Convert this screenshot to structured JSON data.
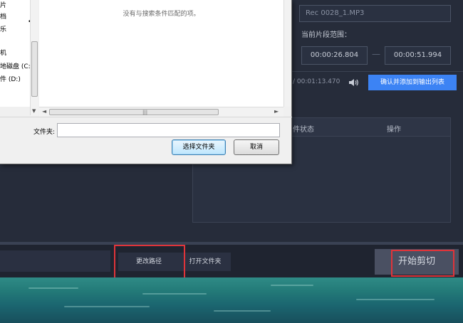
{
  "dialog": {
    "tree_items": [
      "片",
      "档",
      "乐",
      "机",
      "地磁盘 (C:)",
      "件 (D:)"
    ],
    "empty_message": "没有与搜索条件匹配的项。",
    "folder_label": "文件夹:",
    "folder_value": "",
    "select_button": "选择文件夹",
    "cancel_button": "取消"
  },
  "clip": {
    "filename": "Rec 0028_1.MP3",
    "range_label": "当前片段范围：",
    "start_time": "00:00:26.804",
    "end_time": "00:00:51.994",
    "separator": "—",
    "duration": "/ 00:01:13.470",
    "confirm_button": "确认并添加到输出列表"
  },
  "table": {
    "columns": [
      "件状态",
      "操作"
    ]
  },
  "bottom_bar": {
    "change_path_button": "更改路径",
    "open_folder_button": "打开文件夹",
    "start_button": "开始剪切"
  },
  "colors": {
    "accent": "#3c83f4",
    "highlight": "#e0343a",
    "app_bg": "#262c3a"
  }
}
